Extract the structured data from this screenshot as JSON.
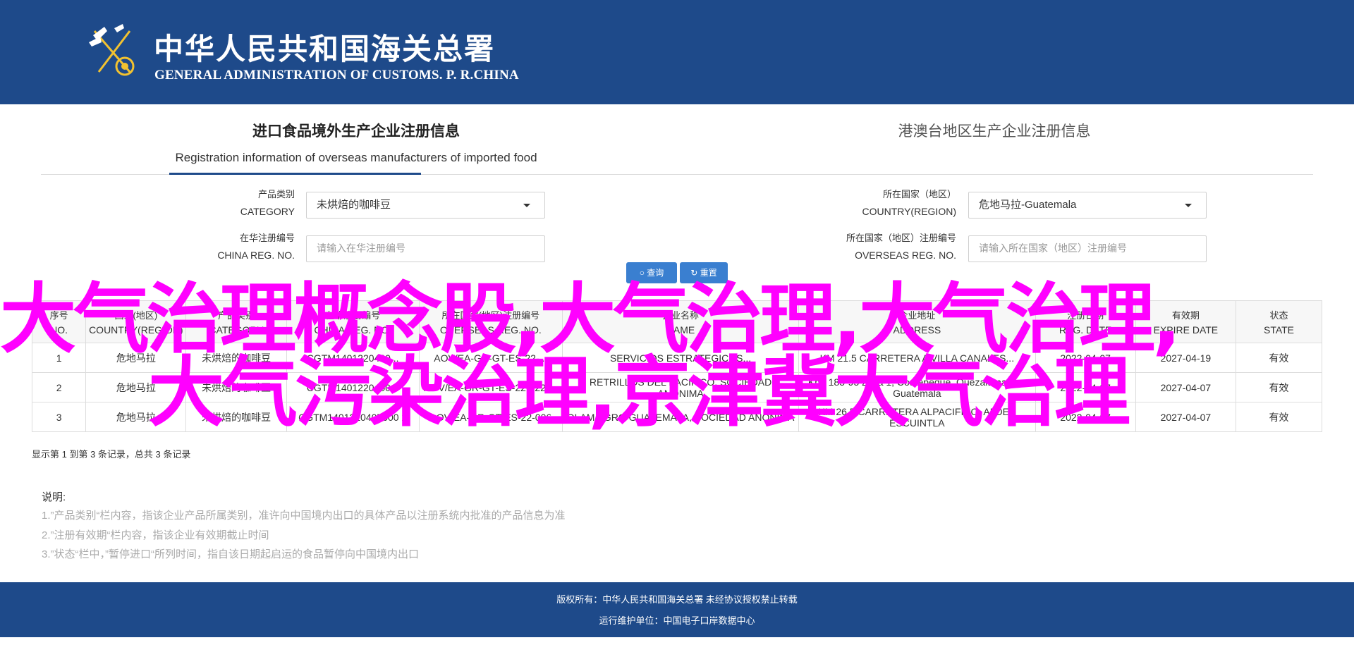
{
  "header": {
    "title_cn": "中华人民共和国海关总署",
    "title_en": "GENERAL ADMINISTRATION OF CUSTOMS. P. R.CHINA"
  },
  "tabs": [
    {
      "label_cn": "进口食品境外生产企业注册信息",
      "label_en": "Registration information of overseas manufacturers of imported food",
      "active": true
    },
    {
      "label_cn": "港澳台地区生产企业注册信息",
      "label_en": "",
      "active": false
    }
  ],
  "form": {
    "category": {
      "label_cn": "产品类别",
      "label_en": "CATEGORY",
      "value": "未烘焙的咖啡豆"
    },
    "country": {
      "label_cn": "所在国家（地区）",
      "label_en": "COUNTRY(REGION)",
      "value": "危地马拉-Guatemala"
    },
    "china_reg": {
      "label_cn": "在华注册编号",
      "label_en": "CHINA REG. NO.",
      "placeholder": "请输入在华注册编号"
    },
    "overseas_reg": {
      "label_cn": "所在国家（地区）注册编号",
      "label_en": "OVERSEAS REG. NO.",
      "placeholder": "请输入所在国家（地区）注册编号"
    },
    "search_label": "查询",
    "reset_label": "重置"
  },
  "table": {
    "headers": [
      {
        "cn": "序号",
        "en": "NO."
      },
      {
        "cn": "国家(地区)",
        "en": "COUNTRY(REGION)"
      },
      {
        "cn": "产品类别",
        "en": "CATEGORY"
      },
      {
        "cn": "在华注册编号",
        "en": "CHINA REG. NO."
      },
      {
        "cn": "所在国家(地区)注册编号",
        "en": "OVERSEAS REG. NO."
      },
      {
        "cn": "企业名称",
        "en": "NAME"
      },
      {
        "cn": "企业地址",
        "en": "ADDRESS"
      },
      {
        "cn": "注册日期",
        "en": "REG. DATE"
      },
      {
        "cn": "有效期",
        "en": "EXPIRE DATE"
      },
      {
        "cn": "状态",
        "en": "STATE"
      }
    ],
    "rows": [
      [
        "1",
        "危地马拉",
        "未烘焙的咖啡豆",
        "CGTM1401220400...",
        "AOV/EA-GR-GT-ES-22-...",
        "SERVICIOS ESTRATEGICOS...",
        "KM 21.5 CARRETERA A VILLA CANALES...",
        "2022-04-07",
        "2027-04-19",
        "有效"
      ],
      [
        "2",
        "危地马拉",
        "未烘焙的咖啡豆",
        "CGTM1401220400...",
        "AOV/EA-GR-GT-ES-22-022-...",
        "RETRILLOS DEL PACIFICO, SOCIEDAD ANONIMA",
        "Km. 185-95 zona 1, Coatepeque, Quezaltenango, Guatemala",
        "2022-04-07",
        "2027-04-07",
        "有效"
      ],
      [
        "3",
        "危地马拉",
        "未烘焙的咖啡豆",
        "CGTM1401220407000 2",
        "AOV/EA-GR-GT-ES-22-006",
        "OLAM AGRO GUATEMALA, SOCIEDAD ANONIMA",
        "KM 26.5 CARRETERA ALPACIFICO, ALDEA ESCUINTLA",
        "2022-04-07",
        "2027-04-07",
        "有效"
      ]
    ]
  },
  "summary": "显示第 1 到第 3 条记录，总共 3 条记录",
  "notes": {
    "title": "说明:",
    "items": [
      "1.”产品类别“栏内容，指该企业产品所属类别，准许向中国境内出口的具体产品以注册系统内批准的产品信息为准",
      "2.”注册有效期“栏内容，指该企业有效期截止时间",
      "3.”状态“栏中，”暂停进口“所列时间，指自该日期起启运的食品暂停向中国境内出口"
    ]
  },
  "overlay": {
    "line1": "大气治理概念股,大气治理,大气治理,",
    "line2": "大气污染治理,京津冀大气治理"
  },
  "footer": {
    "line1": "版权所有：中华人民共和国海关总署 未经协议授权禁止转载",
    "line2": "运行维护单位：中国电子口岸数据中心"
  },
  "colors": {
    "brand_blue": "#1e4a8a",
    "button_blue": "#3a7fd0",
    "overlay_magenta": "#ff00ff"
  }
}
